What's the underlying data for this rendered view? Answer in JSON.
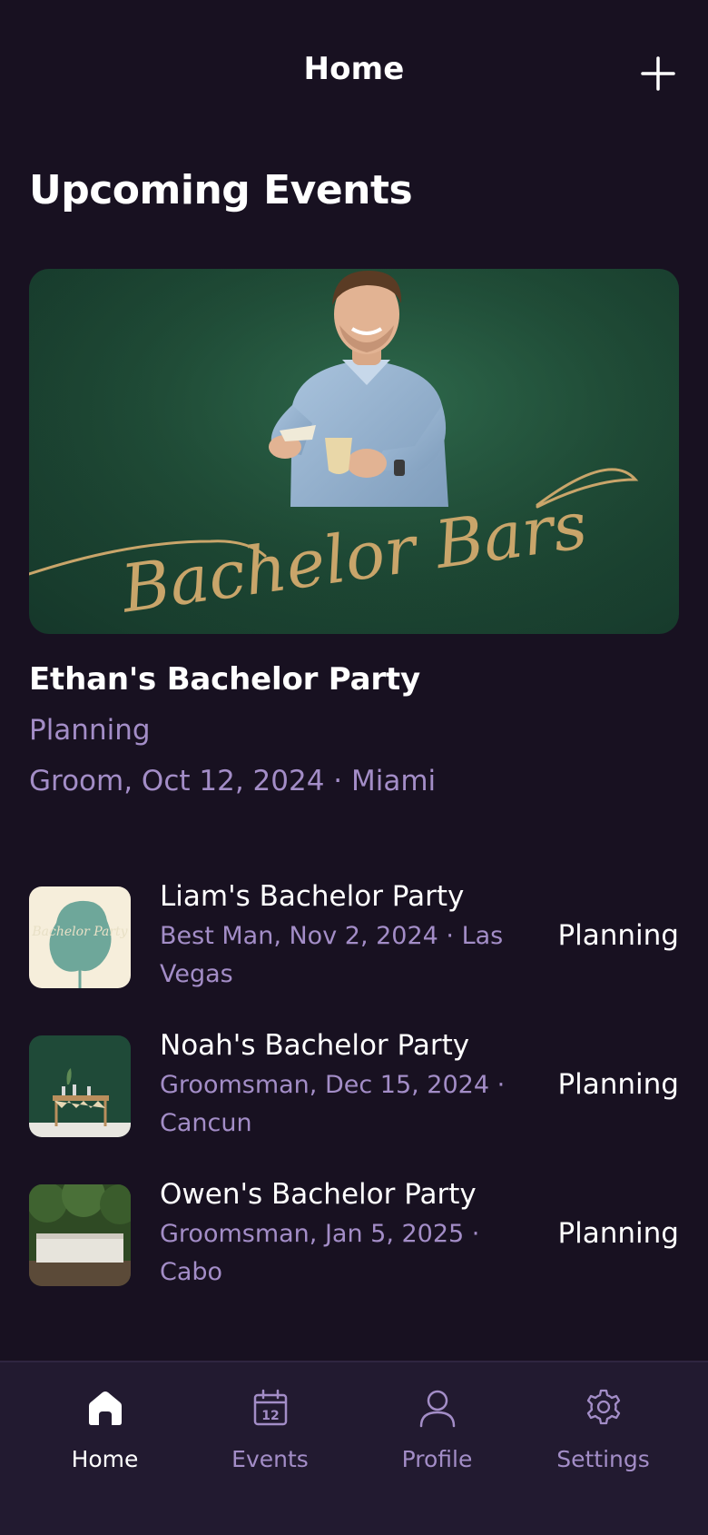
{
  "header": {
    "title": "Home",
    "add_icon": "plus-icon"
  },
  "section": {
    "title": "Upcoming Events"
  },
  "featured": {
    "title": "Ethan's Bachelor Party",
    "status": "Planning",
    "meta": "Groom, Oct 12, 2024 · Miami",
    "image_lettering": "Bachelor Bars"
  },
  "events": [
    {
      "title": "Liam's Bachelor Party",
      "subtitle": "Best Man, Nov 2, 2024 · Las Vegas",
      "status": "Planning",
      "thumb_lettering": "Bachelor Party"
    },
    {
      "title": "Noah's Bachelor Party",
      "subtitle": "Groomsman, Dec 15, 2024 · Cancun",
      "status": "Planning"
    },
    {
      "title": "Owen's Bachelor Party",
      "subtitle": "Groomsman, Jan 5, 2025 · Cabo",
      "status": "Planning"
    }
  ],
  "tabs": [
    {
      "label": "Home",
      "icon": "home-icon",
      "active": true
    },
    {
      "label": "Events",
      "icon": "calendar-icon",
      "active": false,
      "icon_text": "12"
    },
    {
      "label": "Profile",
      "icon": "user-icon",
      "active": false
    },
    {
      "label": "Settings",
      "icon": "gear-icon",
      "active": false
    }
  ],
  "colors": {
    "background": "#181121",
    "tabbar": "#221a30",
    "accent_text": "#a38dc7",
    "primary_text": "#ffffff"
  }
}
